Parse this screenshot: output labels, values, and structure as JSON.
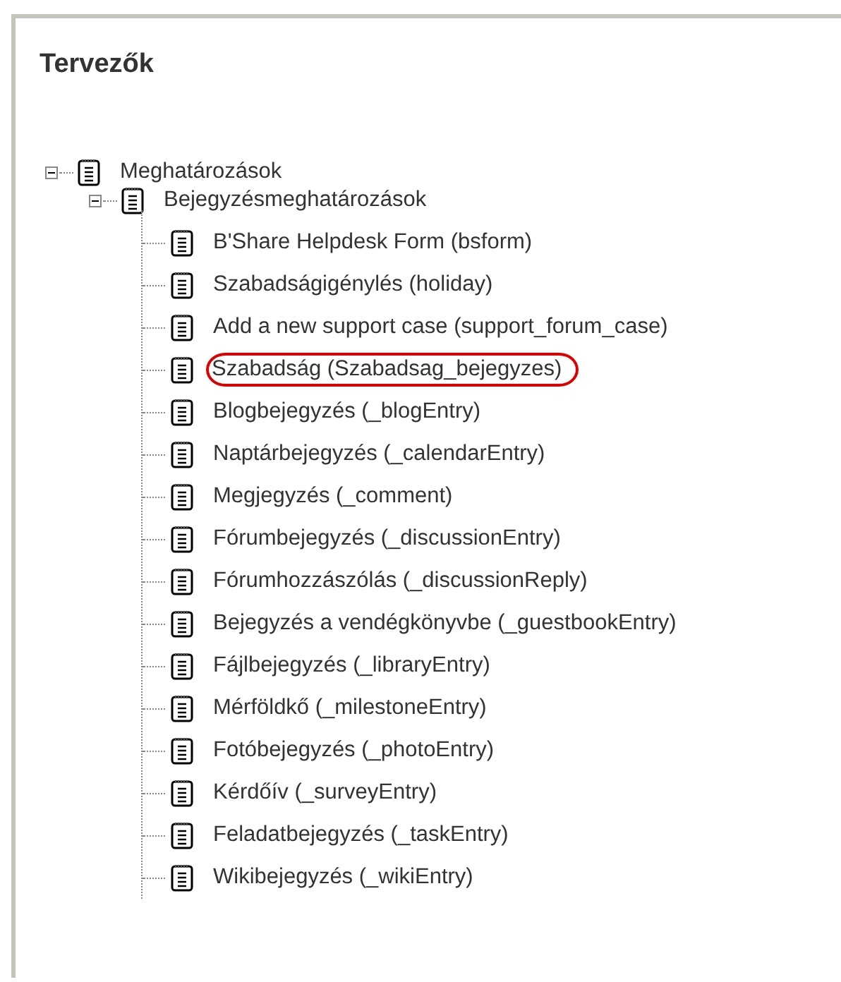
{
  "title": "Tervezők",
  "tree": [
    {
      "label": "Meghatározások",
      "expanded": true,
      "children": [
        {
          "label": "Bejegyzésmeghatározások",
          "expanded": true,
          "children": [
            {
              "label": "B'Share Helpdesk Form (bsform)",
              "highlighted": false
            },
            {
              "label": "Szabadságigénylés (holiday)",
              "highlighted": false
            },
            {
              "label": "Add a new support case (support_forum_case)",
              "highlighted": false
            },
            {
              "label": "Szabadság (Szabadsag_bejegyzes)",
              "highlighted": true
            },
            {
              "label": "Blogbejegyzés (_blogEntry)",
              "highlighted": false
            },
            {
              "label": "Naptárbejegyzés (_calendarEntry)",
              "highlighted": false
            },
            {
              "label": "Megjegyzés (_comment)",
              "highlighted": false
            },
            {
              "label": "Fórumbejegyzés (_discussionEntry)",
              "highlighted": false
            },
            {
              "label": "Fórumhozzászólás (_discussionReply)",
              "highlighted": false
            },
            {
              "label": "Bejegyzés a vendégkönyvbe (_guestbookEntry)",
              "highlighted": false
            },
            {
              "label": "Fájlbejegyzés (_libraryEntry)",
              "highlighted": false
            },
            {
              "label": "Mérföldkő (_milestoneEntry)",
              "highlighted": false
            },
            {
              "label": "Fotóbejegyzés (_photoEntry)",
              "highlighted": false
            },
            {
              "label": "Kérdőív (_surveyEntry)",
              "highlighted": false
            },
            {
              "label": "Feladatbejegyzés (_taskEntry)",
              "highlighted": false
            },
            {
              "label": "Wikibejegyzés (_wikiEntry)",
              "highlighted": false
            }
          ]
        }
      ]
    }
  ]
}
